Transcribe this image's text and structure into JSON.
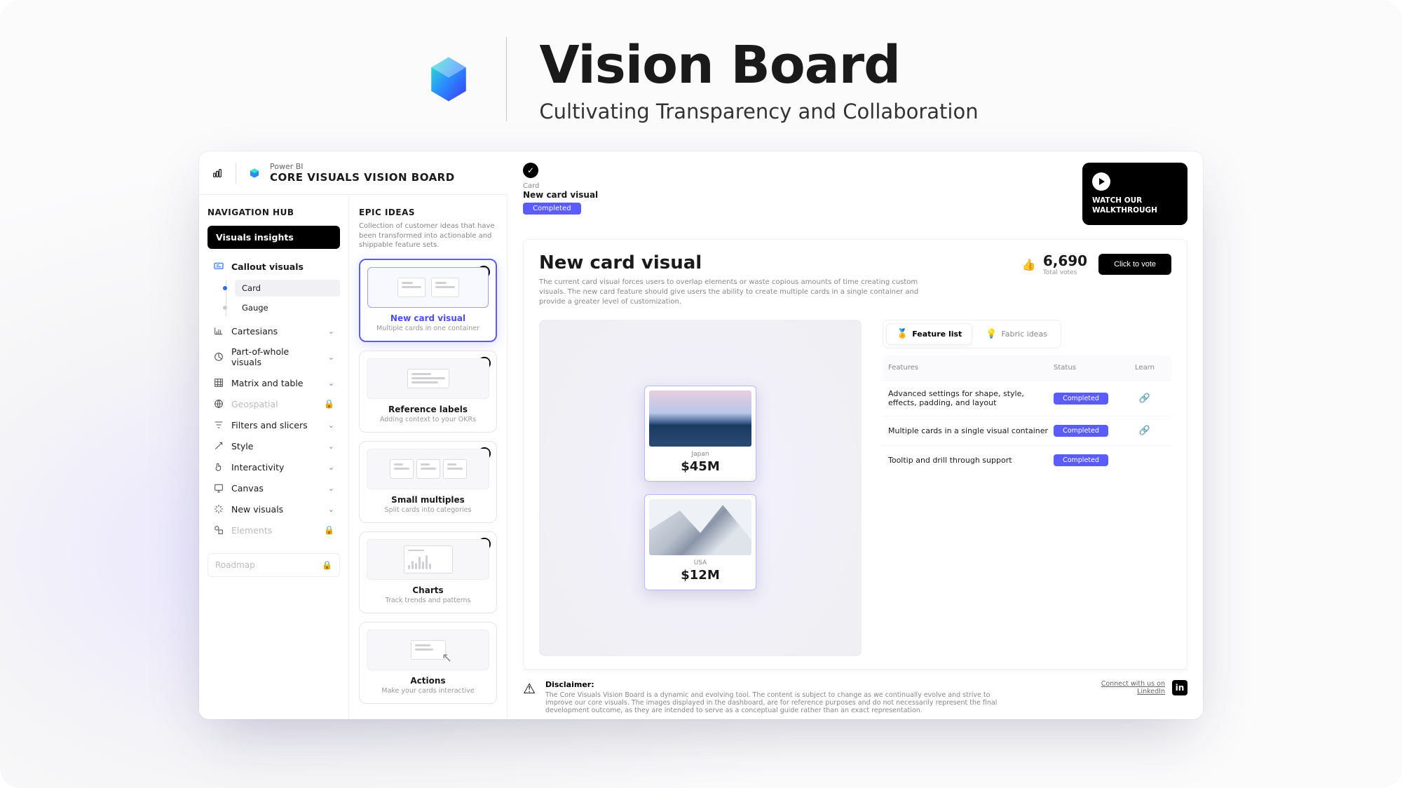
{
  "hero": {
    "title": "Vision Board",
    "subtitle": "Cultivating Transparency and Collaboration"
  },
  "topbar": {
    "brand_small": "Power BI",
    "brand_title": "CORE VISUALS VISION BOARD"
  },
  "sidebar": {
    "heading": "NAVIGATION HUB",
    "primary": "Visuals insights",
    "callout": {
      "label": "Callout visuals"
    },
    "callout_children": [
      {
        "label": "Card",
        "active": true
      },
      {
        "label": "Gauge",
        "active": false
      }
    ],
    "items": [
      {
        "label": "Cartesians",
        "icon": "chart",
        "state": "expand"
      },
      {
        "label": "Part-of-whole visuals",
        "icon": "pie",
        "state": "expand"
      },
      {
        "label": "Matrix and table",
        "icon": "grid",
        "state": "expand"
      },
      {
        "label": "Geospatial",
        "icon": "globe",
        "state": "locked"
      },
      {
        "label": "Filters and slicers",
        "icon": "filter",
        "state": "expand"
      },
      {
        "label": "Style",
        "icon": "style",
        "state": "expand"
      },
      {
        "label": "Interactivity",
        "icon": "hand",
        "state": "expand"
      },
      {
        "label": "Canvas",
        "icon": "canvas",
        "state": "expand"
      },
      {
        "label": "New visuals",
        "icon": "spark",
        "state": "expand"
      },
      {
        "label": "Elements",
        "icon": "shapes",
        "state": "locked"
      }
    ],
    "roadmap": "Roadmap"
  },
  "epics": {
    "heading": "EPIC IDEAS",
    "intro": "Collection of customer ideas that have been transformed into actionable and shippable feature sets.",
    "cards": [
      {
        "title": "New card visual",
        "sub": "Multiple cards in one container",
        "status": "done",
        "active": true
      },
      {
        "title": "Reference labels",
        "sub": "Adding context to your OKRs",
        "status": "done"
      },
      {
        "title": "Small multiples",
        "sub": "Split cards into categories",
        "status": "prog"
      },
      {
        "title": "Charts",
        "sub": "Track trends and patterns",
        "status": "prog"
      },
      {
        "title": "Actions",
        "sub": "Make your cards interactive",
        "status": "none"
      }
    ]
  },
  "main": {
    "crumb": {
      "label": "Card",
      "title": "New card visual",
      "status": "Completed"
    },
    "watch": "WATCH OUR WALKTHROUGH",
    "detail": {
      "title": "New card visual",
      "desc": "The current card visual forces users to overlap elements or waste copious amounts of time creating custom visuals. The new card feature should give users the ability to create multiple cards in a single container and provide a greater level of customization.",
      "votes_n": "6,690",
      "votes_l": "Total votes",
      "vote_btn": "Click to vote"
    },
    "preview": {
      "cards": [
        {
          "label": "Japan",
          "value": "$45M"
        },
        {
          "label": "USA",
          "value": "$12M"
        }
      ]
    },
    "tabs": [
      {
        "label": "Feature list",
        "active": true
      },
      {
        "label": "Fabric ideas",
        "active": false
      }
    ],
    "table": {
      "headers": {
        "a": "Features",
        "b": "Status",
        "c": "Learn"
      },
      "rows": [
        {
          "feature": "Advanced settings for shape, style, effects, padding, and layout",
          "status": "Completed",
          "learn": true
        },
        {
          "feature": "Multiple cards in a single visual container",
          "status": "Completed",
          "learn": true
        },
        {
          "feature": "Tooltip and drill through support",
          "status": "Completed",
          "learn": false
        }
      ]
    },
    "disclaimer": {
      "title": "Disclaimer:",
      "body": "The Core Visuals Vision Board is a dynamic and evolving tool. The content is subject to change as we continually evolve and strive to improve our core visuals. The images displayed in the dashboard, are for reference purposes and do not necessarily represent the final development outcome, as they are intended to serve as a conceptual guide rather than an exact representation.",
      "connect_a": "Connect with us on",
      "connect_b": "LinkedIn"
    }
  }
}
